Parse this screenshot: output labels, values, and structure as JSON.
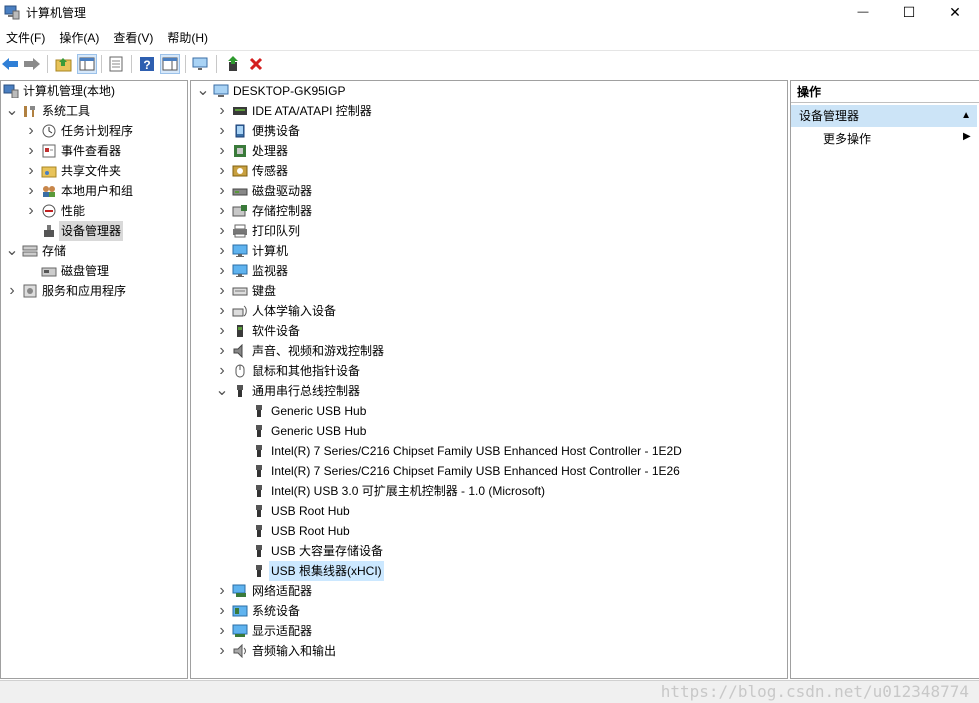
{
  "window": {
    "title": "计算机管理",
    "minimize_glyph": "—",
    "maximize_glyph": "☐",
    "close_glyph": "✕"
  },
  "menu": [
    "文件(F)",
    "操作(A)",
    "查看(V)",
    "帮助(H)"
  ],
  "left_tree": [
    {
      "label": "计算机管理(本地)",
      "icon": "computer-management-icon",
      "depth": 0,
      "arrow": ""
    },
    {
      "label": "系统工具",
      "icon": "tools-icon",
      "depth": 1,
      "arrow": "v"
    },
    {
      "label": "任务计划程序",
      "icon": "clock-icon",
      "depth": 2,
      "arrow": ">"
    },
    {
      "label": "事件查看器",
      "icon": "event-viewer-icon",
      "depth": 2,
      "arrow": ">"
    },
    {
      "label": "共享文件夹",
      "icon": "shared-folder-icon",
      "depth": 2,
      "arrow": ">"
    },
    {
      "label": "本地用户和组",
      "icon": "users-icon",
      "depth": 2,
      "arrow": ">"
    },
    {
      "label": "性能",
      "icon": "performance-icon",
      "depth": 2,
      "arrow": ">"
    },
    {
      "label": "设备管理器",
      "icon": "device-manager-icon",
      "depth": 2,
      "arrow": "",
      "selected": true
    },
    {
      "label": "存储",
      "icon": "storage-icon",
      "depth": 1,
      "arrow": "v"
    },
    {
      "label": "磁盘管理",
      "icon": "disk-icon",
      "depth": 2,
      "arrow": ""
    },
    {
      "label": "服务和应用程序",
      "icon": "services-icon",
      "depth": 1,
      "arrow": ">"
    }
  ],
  "device_tree": [
    {
      "label": "DESKTOP-GK95IGP",
      "icon": "computer-icon",
      "depth": 0,
      "arrow": "v"
    },
    {
      "label": "IDE ATA/ATAPI 控制器",
      "icon": "ide-controller-icon",
      "depth": 1,
      "arrow": ">"
    },
    {
      "label": "便携设备",
      "icon": "portable-device-icon",
      "depth": 1,
      "arrow": ">"
    },
    {
      "label": "处理器",
      "icon": "processor-icon",
      "depth": 1,
      "arrow": ">"
    },
    {
      "label": "传感器",
      "icon": "sensor-icon",
      "depth": 1,
      "arrow": ">"
    },
    {
      "label": "磁盘驱动器",
      "icon": "disk-drive-icon",
      "depth": 1,
      "arrow": ">"
    },
    {
      "label": "存储控制器",
      "icon": "storage-controller-icon",
      "depth": 1,
      "arrow": ">"
    },
    {
      "label": "打印队列",
      "icon": "printer-icon",
      "depth": 1,
      "arrow": ">"
    },
    {
      "label": "计算机",
      "icon": "monitor-icon",
      "depth": 1,
      "arrow": ">"
    },
    {
      "label": "监视器",
      "icon": "monitor-icon",
      "depth": 1,
      "arrow": ">"
    },
    {
      "label": "键盘",
      "icon": "keyboard-icon",
      "depth": 1,
      "arrow": ">"
    },
    {
      "label": "人体学输入设备",
      "icon": "hid-icon",
      "depth": 1,
      "arrow": ">"
    },
    {
      "label": "软件设备",
      "icon": "software-device-icon",
      "depth": 1,
      "arrow": ">"
    },
    {
      "label": "声音、视频和游戏控制器",
      "icon": "speaker-icon",
      "depth": 1,
      "arrow": ">"
    },
    {
      "label": "鼠标和其他指针设备",
      "icon": "mouse-icon",
      "depth": 1,
      "arrow": ">"
    },
    {
      "label": "通用串行总线控制器",
      "icon": "usb-icon",
      "depth": 1,
      "arrow": "v"
    },
    {
      "label": "Generic USB Hub",
      "icon": "usb-icon",
      "depth": 2,
      "arrow": ""
    },
    {
      "label": "Generic USB Hub",
      "icon": "usb-icon",
      "depth": 2,
      "arrow": ""
    },
    {
      "label": "Intel(R) 7 Series/C216 Chipset Family USB Enhanced Host Controller - 1E2D",
      "icon": "usb-icon",
      "depth": 2,
      "arrow": ""
    },
    {
      "label": "Intel(R) 7 Series/C216 Chipset Family USB Enhanced Host Controller - 1E26",
      "icon": "usb-icon",
      "depth": 2,
      "arrow": ""
    },
    {
      "label": "Intel(R) USB 3.0 可扩展主机控制器 - 1.0 (Microsoft)",
      "icon": "usb-icon",
      "depth": 2,
      "arrow": ""
    },
    {
      "label": "USB Root Hub",
      "icon": "usb-icon",
      "depth": 2,
      "arrow": ""
    },
    {
      "label": "USB Root Hub",
      "icon": "usb-icon",
      "depth": 2,
      "arrow": ""
    },
    {
      "label": "USB 大容量存储设备",
      "icon": "usb-icon",
      "depth": 2,
      "arrow": ""
    },
    {
      "label": "USB 根集线器(xHCI)",
      "icon": "usb-icon",
      "depth": 2,
      "arrow": "",
      "selected": true
    },
    {
      "label": "网络适配器",
      "icon": "network-adapter-icon",
      "depth": 1,
      "arrow": ">"
    },
    {
      "label": "系统设备",
      "icon": "system-device-icon",
      "depth": 1,
      "arrow": ">"
    },
    {
      "label": "显示适配器",
      "icon": "display-adapter-icon",
      "depth": 1,
      "arrow": ">"
    },
    {
      "label": "音频输入和输出",
      "icon": "audio-io-icon",
      "depth": 1,
      "arrow": ">"
    }
  ],
  "actions": {
    "header": "操作",
    "section": "设备管理器",
    "more": "更多操作"
  },
  "watermark": "https://blog.csdn.net/u012348774"
}
